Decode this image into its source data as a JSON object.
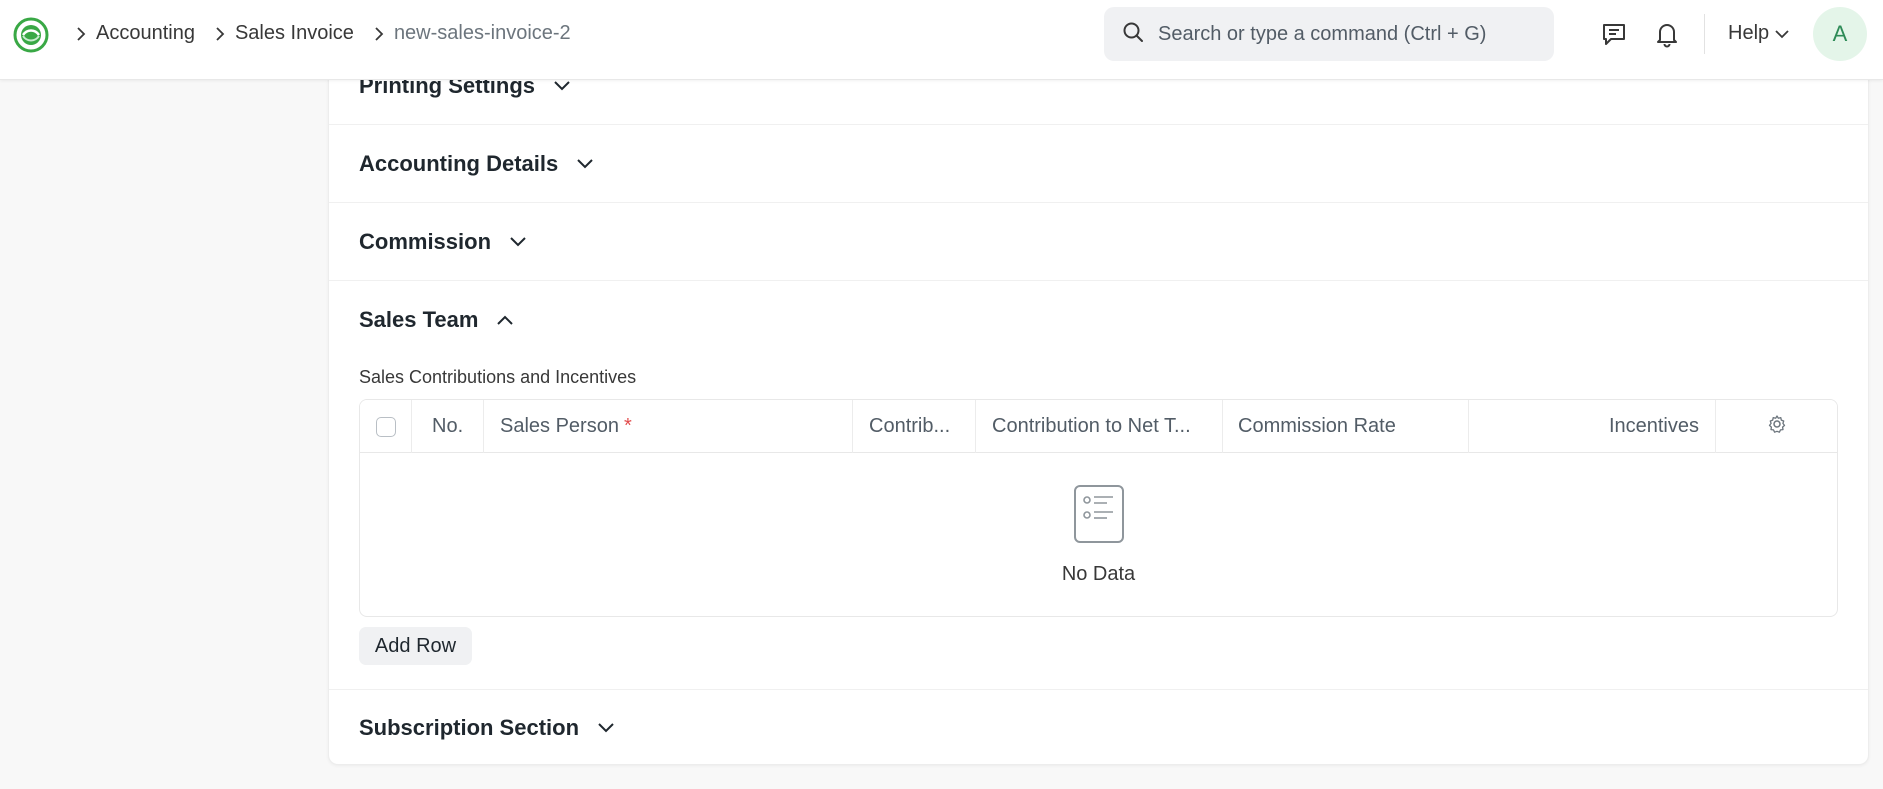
{
  "navbar": {
    "breadcrumbs": [
      "Accounting",
      "Sales Invoice",
      "new-sales-invoice-2"
    ],
    "search_placeholder": "Search or type a command (Ctrl + G)",
    "help_label": "Help",
    "avatar_initial": "A",
    "brand_color": "#39a845"
  },
  "sections": {
    "printing_settings": "Printing Settings",
    "accounting_details": "Accounting Details",
    "commission": "Commission",
    "sales_team": "Sales Team",
    "subscription_section": "Subscription Section"
  },
  "sales_team": {
    "subtitle": "Sales Contributions and Incentives",
    "columns": {
      "no": "No.",
      "sales_person": "Sales Person",
      "required_mark": "*",
      "contribution": "Contrib...",
      "contribution_net": "Contribution to Net T...",
      "commission_rate": "Commission Rate",
      "incentives": "Incentives"
    },
    "empty_text": "No Data",
    "add_row_label": "Add Row"
  },
  "icons": {
    "logo": "app-logo-icon",
    "search": "search-icon",
    "chat": "chat-icon",
    "bell": "bell-icon",
    "chevron": "chevron-down-icon",
    "settings": "gear-icon",
    "empty": "empty-list-icon"
  }
}
